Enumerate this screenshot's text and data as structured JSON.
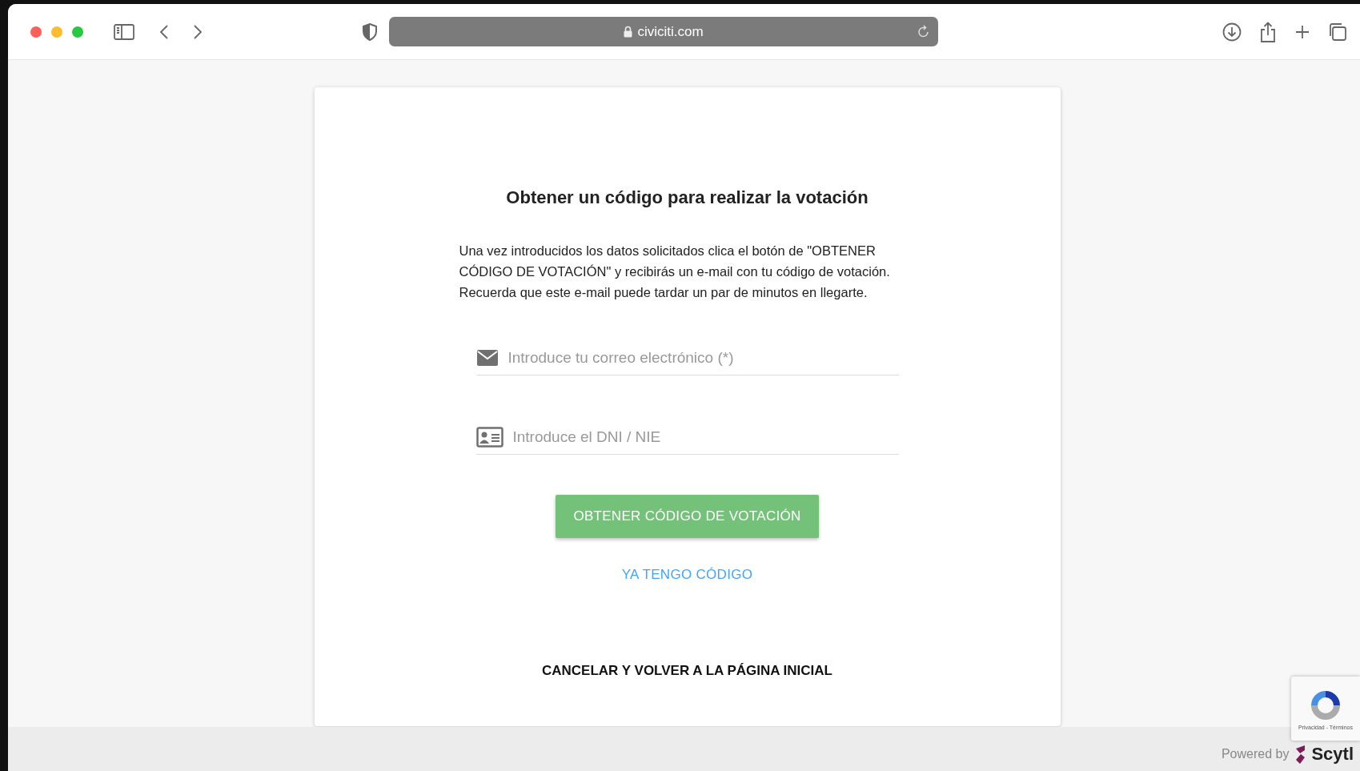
{
  "browser": {
    "url": "civiciti.com"
  },
  "heading": "Obtener un código para realizar la votación",
  "instructions": "Una vez introducidos los datos solicitados clica el botón de \"OBTENER CÓDIGO DE VOTACIÓN\" y recibirás un e-mail con tu código de votación. Recuerda que este e-mail puede tardar un par de minutos en llegarte.",
  "fields": [
    {
      "kind": "email",
      "placeholder": "Introduce tu correo electrónico (*)"
    },
    {
      "kind": "id",
      "placeholder": "Introduce el DNI / NIE"
    }
  ],
  "submit_button": "OBTENER CÓDIGO DE VOTACIÓN",
  "code_link": "YA TENGO CÓDIGO",
  "cancel_link": "CANCELAR Y VOLVER A LA PÁGINA INICIAL",
  "recaptcha": {
    "terms": "Privacidad - Términos"
  },
  "footer": {
    "powered_by": "Powered by",
    "brand": "Scytl"
  }
}
